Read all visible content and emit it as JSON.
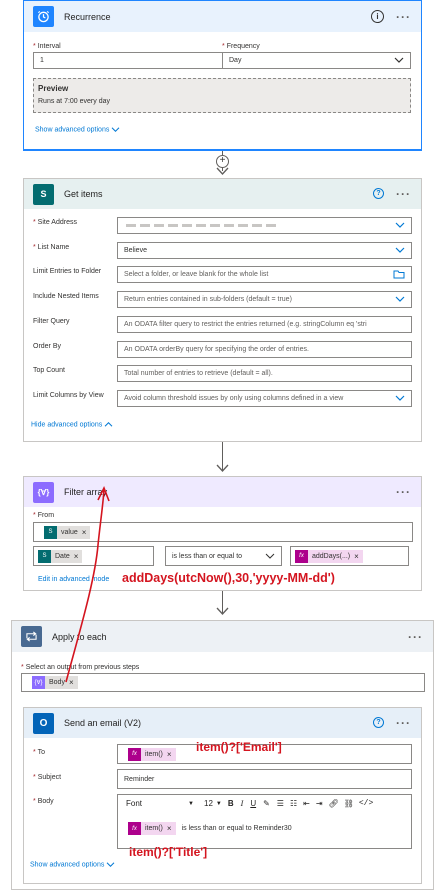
{
  "recurrence": {
    "title": "Recurrence",
    "interval_label": "Interval",
    "interval_value": "1",
    "frequency_label": "Frequency",
    "frequency_value": "Day",
    "preview_title": "Preview",
    "preview_text": "Runs at 7:00 every day",
    "advanced": "Show advanced options",
    "color": "#1f85ff"
  },
  "get_items": {
    "title": "Get items",
    "color": "#036c70",
    "fields": [
      {
        "label": "Site Address",
        "required": true,
        "value": "",
        "placeholder": "",
        "kind": "dropdown"
      },
      {
        "label": "List Name",
        "required": true,
        "value": "Believe",
        "placeholder": "",
        "kind": "dropdown"
      },
      {
        "label": "Limit Entries to Folder",
        "required": false,
        "value": "",
        "placeholder": "Select a folder, or leave blank for the whole list",
        "kind": "folder"
      },
      {
        "label": "Include Nested Items",
        "required": false,
        "value": "",
        "placeholder": "Return entries contained in sub-folders (default = true)",
        "kind": "dropdown"
      },
      {
        "label": "Filter Query",
        "required": false,
        "value": "",
        "placeholder": "An ODATA filter query to restrict the entries returned (e.g. stringColumn eq 'stri",
        "kind": "text"
      },
      {
        "label": "Order By",
        "required": false,
        "value": "",
        "placeholder": "An ODATA orderBy query for specifying the order of entries.",
        "kind": "text"
      },
      {
        "label": "Top Count",
        "required": false,
        "value": "",
        "placeholder": "Total number of entries to retrieve (default = all).",
        "kind": "text"
      },
      {
        "label": "Limit Columns by View",
        "required": false,
        "value": "",
        "placeholder": "Avoid column threshold issues by only using columns defined in a view",
        "kind": "dropdown"
      }
    ],
    "advanced": "Hide advanced options"
  },
  "filter_array": {
    "title": "Filter array",
    "color": "#8c6cff",
    "from_label": "From",
    "from_token": "value",
    "left_token": "Date",
    "operator": "is less than or equal to",
    "right_token": "addDays(...)",
    "edit_link": "Edit in advanced mode"
  },
  "apply_each": {
    "title": "Apply to each",
    "color": "#486991",
    "select_label": "Select an output from previous steps",
    "select_token": "Body"
  },
  "send_email": {
    "title": "Send an email (V2)",
    "color": "#0364b8",
    "to_label": "To",
    "to_token": "item()",
    "subject_label": "Subject",
    "subject_value": "Reminder",
    "body_label": "Body",
    "font_value": "Font",
    "size_value": "12",
    "body_token": "item()",
    "body_text": "is less than or equal to Reminder30",
    "advanced": "Show advanced options"
  },
  "annotations": {
    "add_days": "addDays(utcNow(),30,'yyyy-MM-dd')",
    "email": "item()?['Email']",
    "title": "item()?['Title']",
    "color": "#d4141f"
  }
}
